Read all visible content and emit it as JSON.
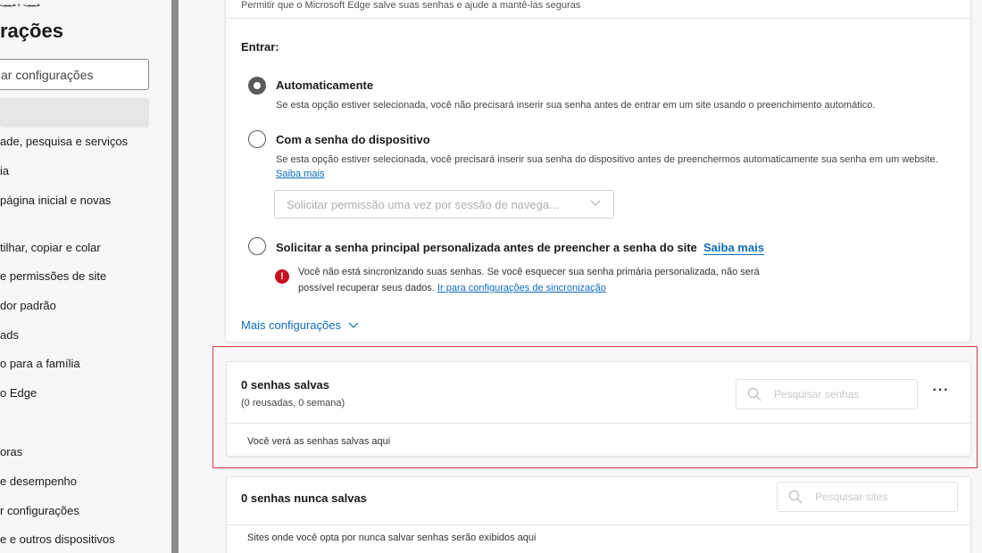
{
  "sidebar": {
    "clipped_top_text": "‿͜ ̥ ̧ ‿͜ ̧",
    "title": "rações",
    "search_placeholder": "ar configurações",
    "items": [
      {
        "label": "ade, pesquisa e serviços"
      },
      {
        "label": "ia"
      },
      {
        "label": "página inicial e novas"
      },
      {
        "label": "tilhar, copiar e colar"
      },
      {
        "label": "e permissões de site"
      },
      {
        "label": "dor padrão"
      },
      {
        "label": "ads"
      },
      {
        "label": "o para a família"
      },
      {
        "label": "o Edge"
      },
      {
        "label": "oras"
      },
      {
        "label": "e desempenho"
      },
      {
        "label": "r configurações"
      },
      {
        "label": "e e outros dispositivos"
      }
    ]
  },
  "top_card": {
    "clipped_text": "Permitir que o Microsoft Edge salve suas senhas e ajude a mantê-las seguras",
    "section_label": "Entrar:",
    "options": [
      {
        "title": "Automaticamente",
        "desc": "Se esta opção estiver selecionada, você não precisará inserir sua senha antes de entrar em um site usando o preenchimento automático.",
        "selected": true
      },
      {
        "title": "Com a senha do dispositivo",
        "desc": "Se esta opção estiver selecionada, você precisará inserir sua senha do dispositivo antes de preenchermos automaticamente sua senha em um website.",
        "link": "Saiba mais",
        "selected": false
      },
      {
        "title": "Solicitar a senha principal personalizada antes de preencher a senha do site",
        "link": "Saiba mais",
        "selected": false
      }
    ],
    "device_select_value": "Solicitar permissão uma vez por sessão de navega...",
    "warning_text": "Você não está sincronizando suas senhas. Se você esquecer sua senha primária personalizada, não será possível recuperar seus dados.",
    "warning_link": "Ir para configurações de sincronização",
    "more_settings": "Mais configurações"
  },
  "saved_card": {
    "title": "0 senhas salvas",
    "subtitle": "(0 reusadas, 0 semana)",
    "search_placeholder": "Pesquisar senhas",
    "more_label": "···",
    "empty_text": "Você verá as senhas salvas aqui"
  },
  "never_card": {
    "title": "0 senhas nunca salvas",
    "search_placeholder": "Pesquisar sites",
    "empty_text": "Sites onde você opta por nunca salvar senhas serão exibidos aqui"
  },
  "colors": {
    "accent": "#0f6cbd",
    "warning": "#c50f1f",
    "highlight_frame": "#e0393e"
  }
}
